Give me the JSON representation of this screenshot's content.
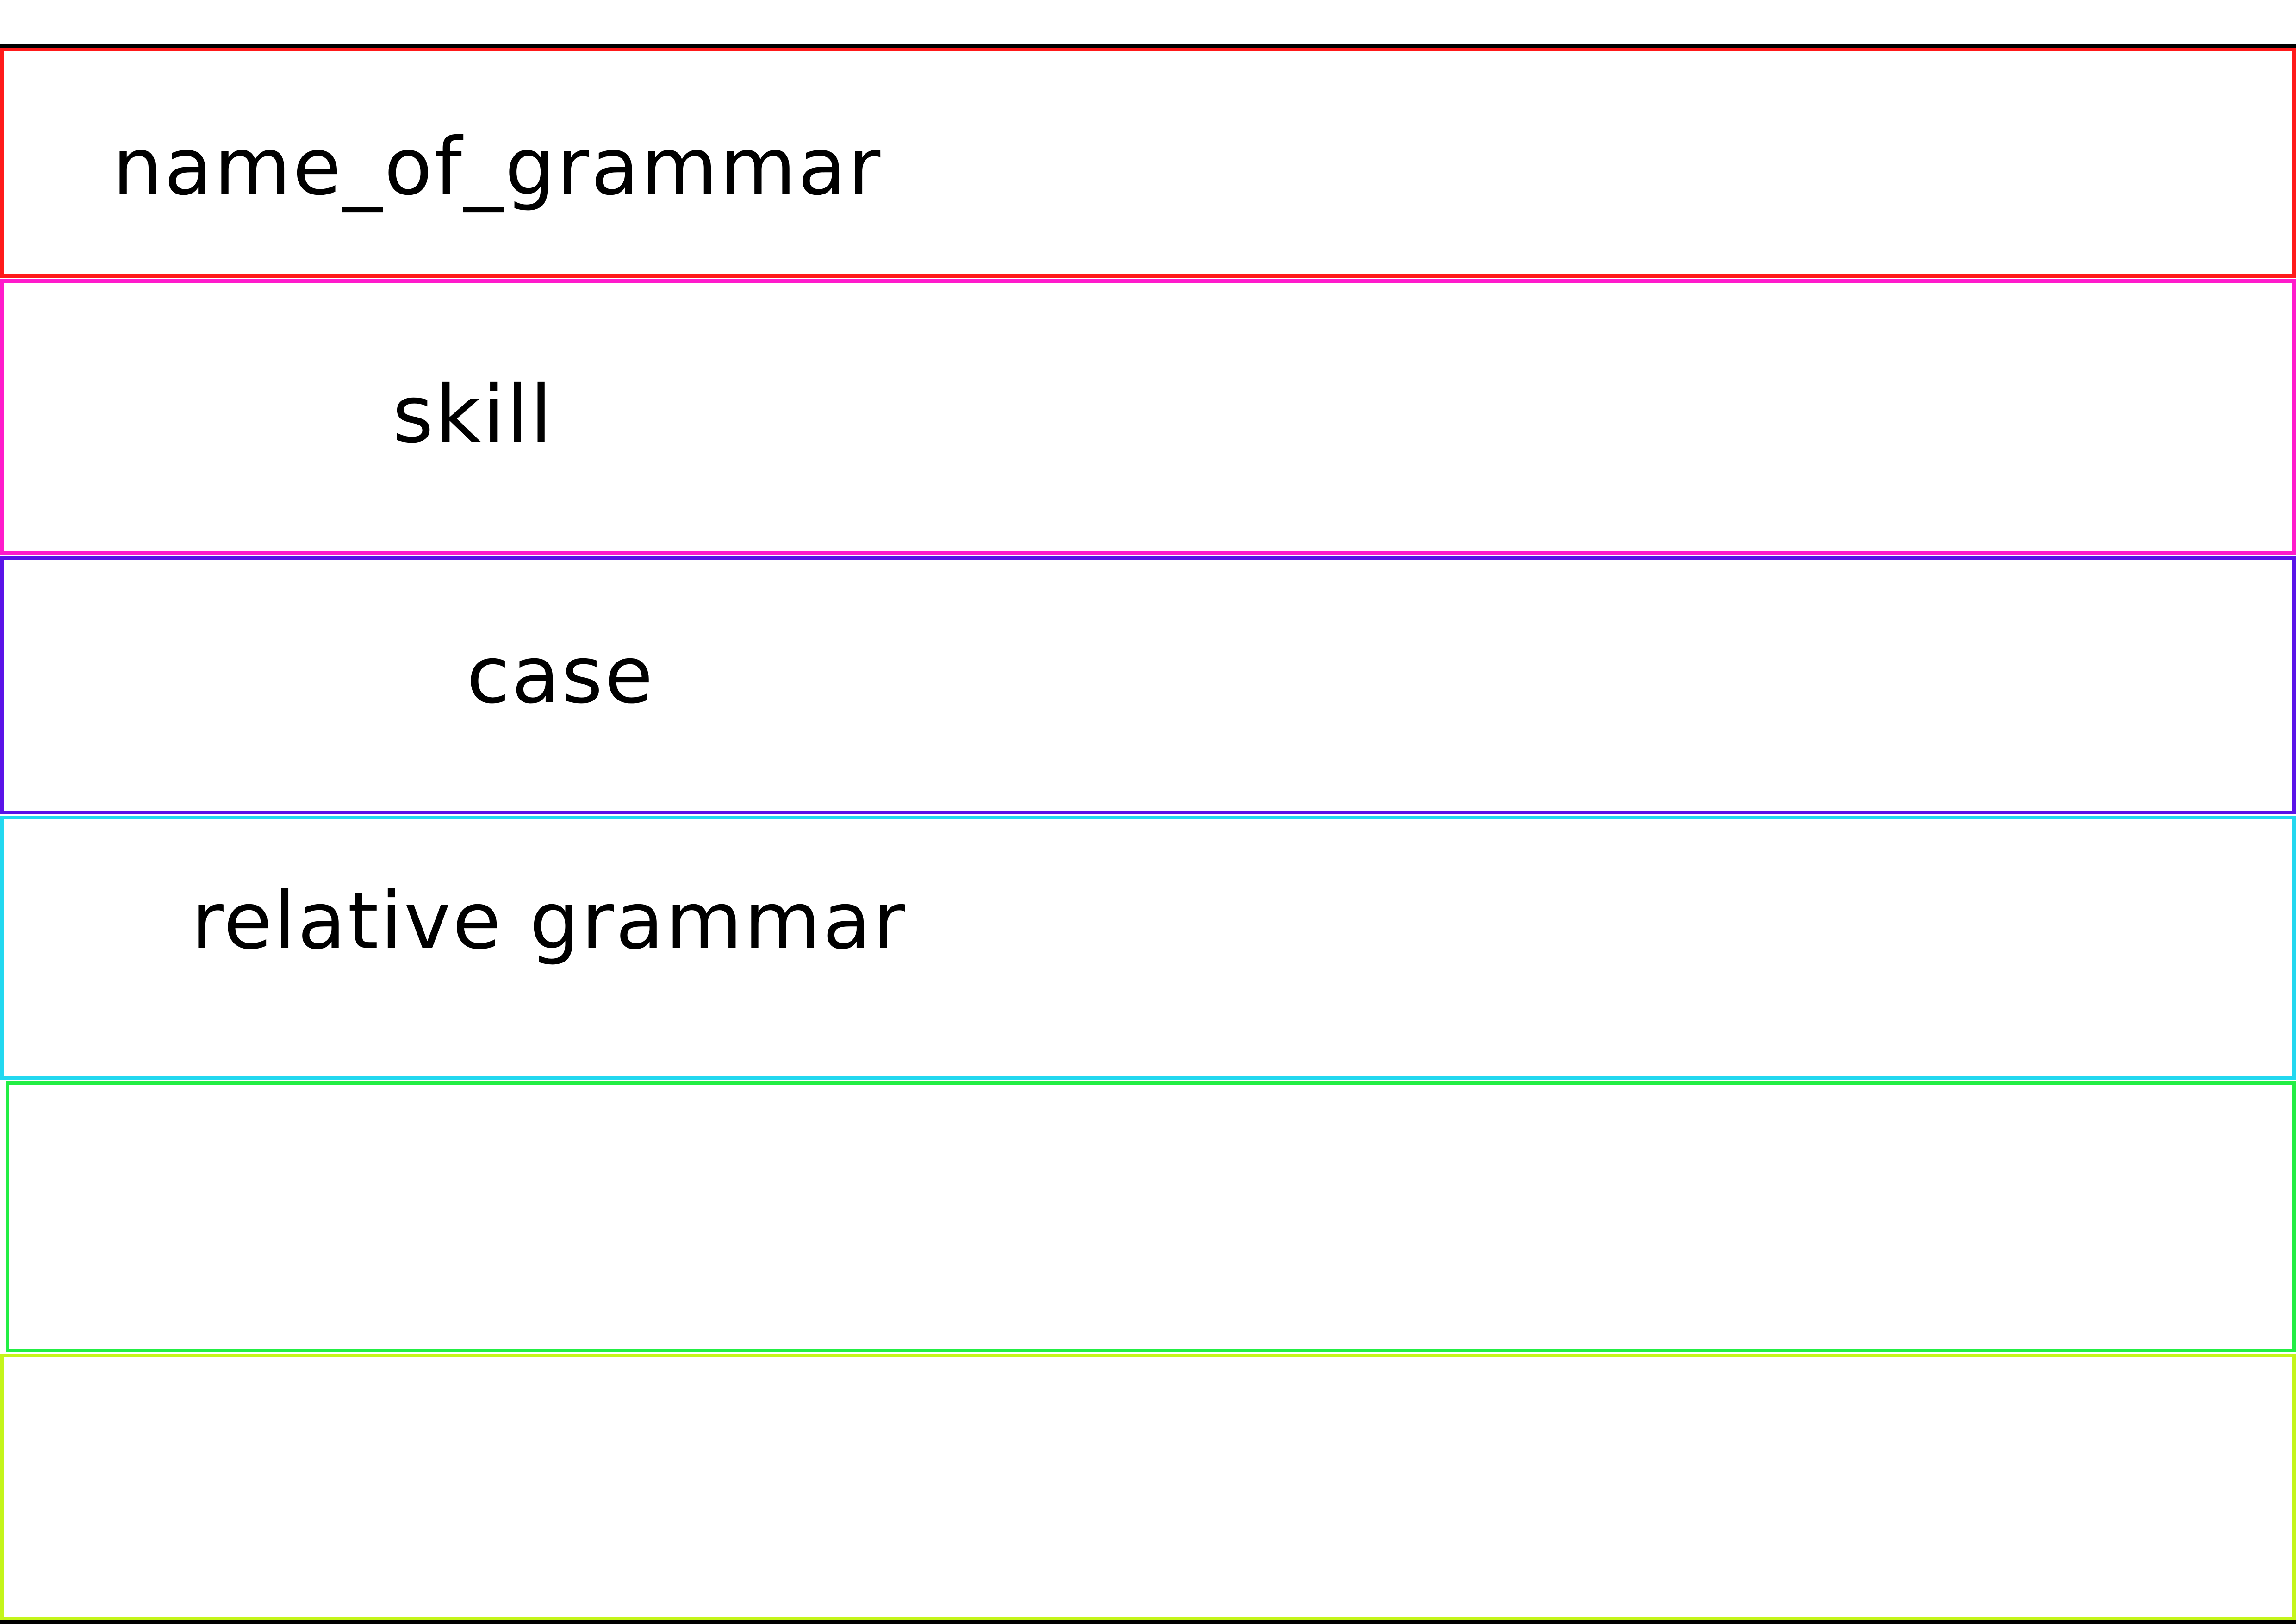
{
  "rows": [
    {
      "label": "name_of_grammar",
      "color": "#ff1a1a"
    },
    {
      "label": "skill",
      "color": "#ff1acb"
    },
    {
      "label": "case",
      "color": "#5a12e8"
    },
    {
      "label": "relative grammar",
      "color": "#22d8f0"
    },
    {
      "label": "",
      "color": "#22ee44"
    },
    {
      "label": "",
      "color": "#c4f51a"
    }
  ]
}
